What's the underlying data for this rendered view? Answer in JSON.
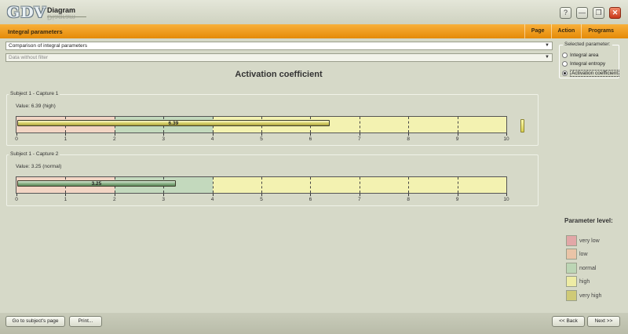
{
  "app": {
    "logo_text": "GDV",
    "title": "Diagram",
    "window_buttons": {
      "help": "?",
      "minimize": "—",
      "restore": "❐",
      "close": "✕"
    }
  },
  "toolbar": {
    "section_title": "Integral parameters",
    "menu": [
      "Page",
      "Action",
      "Programs"
    ]
  },
  "selectors": {
    "comparison": "Comparison of integral parameters",
    "filter": "Data without filter"
  },
  "parameters_box": {
    "legend": "Selected parameter:",
    "options": [
      {
        "label": "Integral area",
        "selected": false
      },
      {
        "label": "Integral entropy",
        "selected": false
      },
      {
        "label": "Activation coefficient",
        "selected": true
      }
    ]
  },
  "chart_title": "Activation coefficient",
  "chart_data": [
    {
      "type": "bar",
      "title": "Subject 1 - Capture 1",
      "value_text": "Value: 6.39 (high)",
      "value": 6.39,
      "bar_label": "6.39",
      "level": "high",
      "xlim": [
        0,
        10
      ],
      "ticks": [
        "0",
        "1",
        "2",
        "3",
        "4",
        "5",
        "6",
        "7",
        "8",
        "9",
        "10"
      ],
      "warning_icon": "exclamation-icon"
    },
    {
      "type": "bar",
      "title": "Subject 1 - Capture 2",
      "value_text": "Value: 3.25 (normal)",
      "value": 3.25,
      "bar_label": "3.25",
      "level": "normal",
      "xlim": [
        0,
        10
      ],
      "ticks": [
        "0",
        "1",
        "2",
        "3",
        "4",
        "5",
        "6",
        "7",
        "8",
        "9",
        "10"
      ]
    }
  ],
  "zones": [
    {
      "level": "low",
      "from": 0,
      "to": 2,
      "color": "#f2d5c4"
    },
    {
      "level": "normal",
      "from": 2,
      "to": 4,
      "color": "#c3d9bd"
    },
    {
      "level": "high",
      "from": 4,
      "to": 10,
      "color": "#f3f2b1"
    }
  ],
  "legend": {
    "title": "Parameter level:",
    "items": [
      {
        "label": "very low",
        "color": "#e2a7a7"
      },
      {
        "label": "low",
        "color": "#eac4a7"
      },
      {
        "label": "normal",
        "color": "#bcd6b5"
      },
      {
        "label": "high",
        "color": "#eeeca4"
      },
      {
        "label": "very high",
        "color": "#cfca77"
      }
    ]
  },
  "footer": {
    "goto_subject": "Go to subject's page",
    "print": "Print...",
    "back": "<< Back",
    "next": "Next >>"
  }
}
